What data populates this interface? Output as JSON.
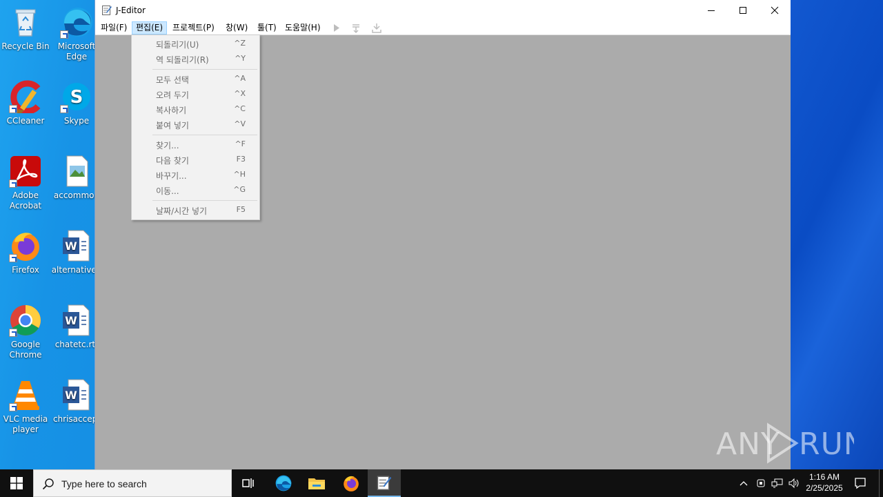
{
  "desktop": {
    "icons": [
      {
        "label": "Recycle Bin",
        "icon": "recycle-bin-icon"
      },
      {
        "label": "Microsoft Edge",
        "icon": "edge-icon"
      },
      {
        "label": "CCleaner",
        "icon": "ccleaner-icon"
      },
      {
        "label": "Skype",
        "icon": "skype-icon"
      },
      {
        "label": "Adobe Acrobat",
        "icon": "acrobat-icon"
      },
      {
        "label": "accommod",
        "icon": "image-file-icon"
      },
      {
        "label": "Firefox",
        "icon": "firefox-icon"
      },
      {
        "label": "alternativeu",
        "icon": "word-doc-icon"
      },
      {
        "label": "Google Chrome",
        "icon": "chrome-icon"
      },
      {
        "label": "chatetc.rtf",
        "icon": "word-doc-icon"
      },
      {
        "label": "VLC media player",
        "icon": "vlc-icon"
      },
      {
        "label": "chrisaccep.",
        "icon": "word-doc-icon"
      }
    ]
  },
  "window": {
    "title": "J-Editor",
    "menu": [
      "파일(F)",
      "편집(E)",
      "프로젝트(P)",
      "창(W)",
      "툴(T)",
      "도움말(H)"
    ],
    "active_menu": "편집(E)"
  },
  "edit_menu": {
    "items": [
      {
        "label": "되돌리기(U)",
        "shortcut": "^Z"
      },
      {
        "label": "역 되돌리기(R)",
        "shortcut": "^Y"
      },
      {
        "label": "모두 선택",
        "shortcut": "^A"
      },
      {
        "label": "오려 두기",
        "shortcut": "^X"
      },
      {
        "label": "복사하기",
        "shortcut": "^C"
      },
      {
        "label": "붙여 넣기",
        "shortcut": "^V"
      },
      {
        "label": "찾기...",
        "shortcut": "^F"
      },
      {
        "label": "다음 찾기",
        "shortcut": "F3"
      },
      {
        "label": "바꾸기...",
        "shortcut": "^H"
      },
      {
        "label": "이동...",
        "shortcut": "^G"
      },
      {
        "label": "날짜/시간 넣기",
        "shortcut": "F5"
      }
    ]
  },
  "watermark": "ANY RUN",
  "taskbar": {
    "search_placeholder": "Type here to search",
    "time": "1:16 AM",
    "date": "2/25/2025"
  },
  "colors": {
    "accent": "#0078d7",
    "menu_highlight": "#cce8ff",
    "window_client": "#ababab",
    "taskbar": "#101010"
  }
}
